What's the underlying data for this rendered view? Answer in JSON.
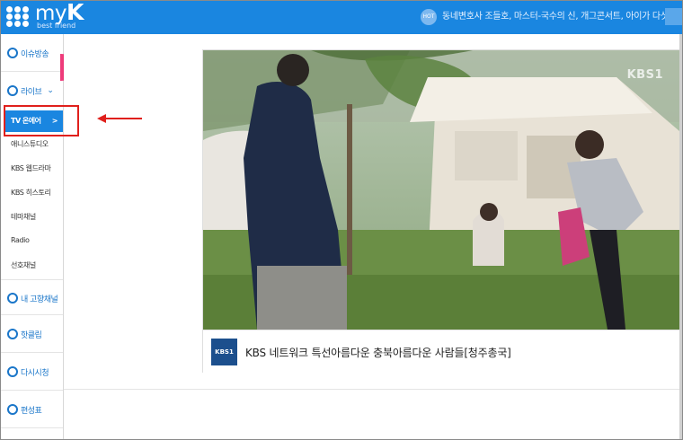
{
  "header": {
    "logo_main": "my",
    "logo_accent": "K",
    "logo_sub": "best friend",
    "hot_badge": "HOT",
    "hot_text": "동네변호사 조들호, 마스터-국수의 신, 개그콘서트, 아이가 다섯"
  },
  "sidebar": {
    "issue": "이슈방송",
    "live": "라이브",
    "live_sub": [
      "TV 온에어",
      "애니스튜디오",
      "KBS 웹드라마",
      "KBS 히스토리",
      "테마채널",
      "Radio",
      "선호채널"
    ],
    "active_arrow": ">",
    "my_channel": "내 고향채널",
    "hot_clip": "핫클립",
    "replay": "다시시청",
    "schedule": "편성표",
    "chevron": "⌄",
    "pink_tab": "‹"
  },
  "player": {
    "watermark": "KBS1",
    "channel_logo": "KBS1",
    "caption": "KBS 네트워크 특선아름다운 충북아름다운 사람들[청주총국]"
  },
  "colors": {
    "brand_blue": "#1a86e0",
    "annotation_red": "#e0201c",
    "pink": "#ee3b7a"
  }
}
